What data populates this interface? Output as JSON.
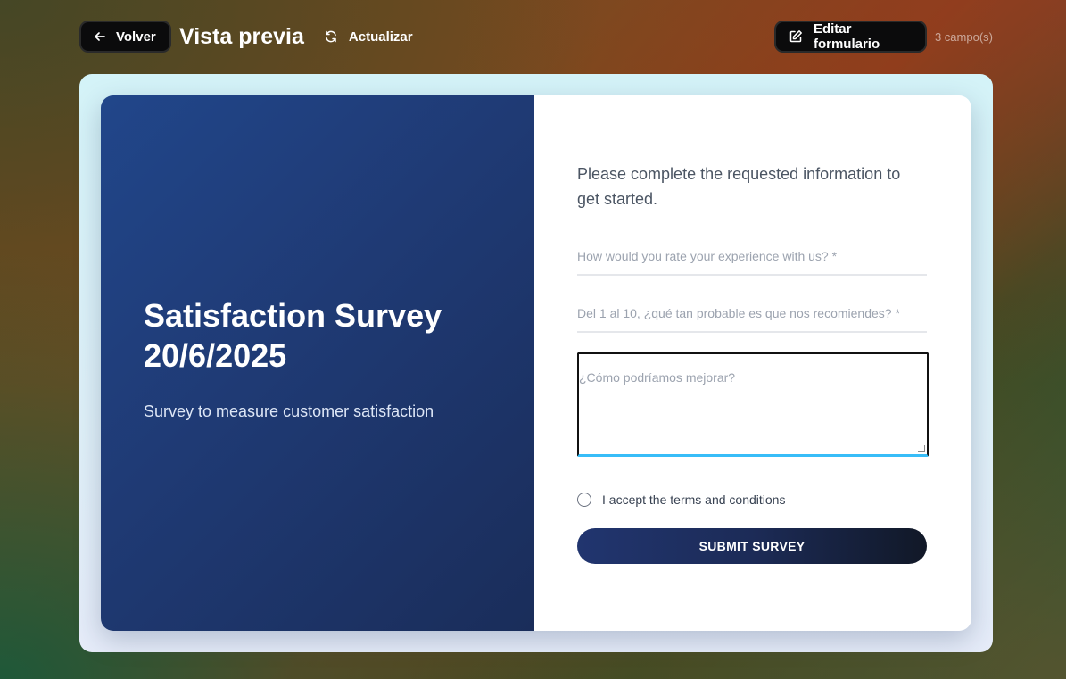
{
  "header": {
    "back_label": "Volver",
    "title": "Vista previa",
    "refresh_label": "Actualizar",
    "edit_label": "Editar formulario",
    "fields_count": "3 campo(s)"
  },
  "form": {
    "title": "Satisfaction Survey 20/6/2025",
    "description": "Survey to measure customer satisfaction",
    "intro": "Please complete the requested information to get started.",
    "fields": [
      {
        "placeholder": "How would you rate your experience with us? *",
        "value": ""
      },
      {
        "placeholder": "Del 1 al 10, ¿qué tan probable es que nos recomiendes? *",
        "value": ""
      },
      {
        "placeholder": "¿Cómo podríamos mejorar?",
        "value": ""
      }
    ],
    "terms_label": "I accept the terms and conditions",
    "terms_checked": false,
    "submit_label": "SUBMIT SURVEY"
  },
  "icons": {
    "back": "arrow-left-icon",
    "refresh": "refresh-icon",
    "edit": "edit-icon"
  },
  "colors": {
    "left_panel": "#1f3a74",
    "submit_start": "#21356f",
    "submit_end": "#111827",
    "focus_underline": "#38bdf8"
  }
}
